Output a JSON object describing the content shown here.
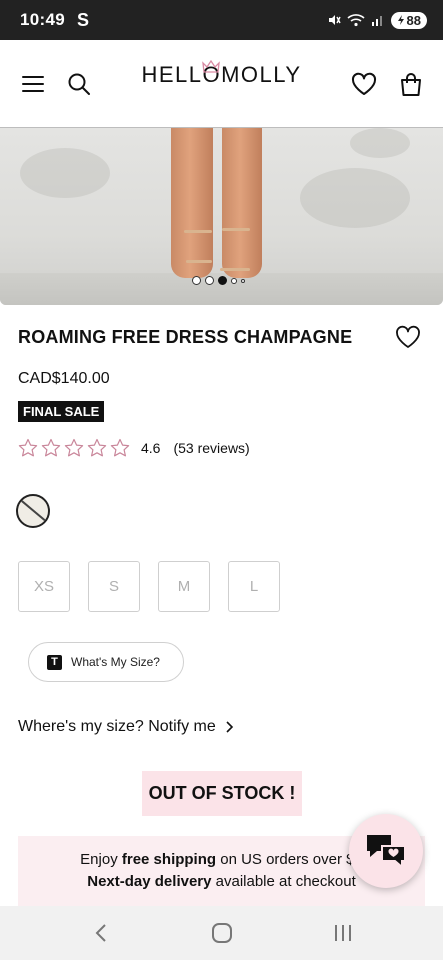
{
  "status_bar": {
    "time": "10:49",
    "carrier_icon": "S",
    "battery": "88",
    "icons": [
      "mute-icon",
      "wifi-icon",
      "signal-icon",
      "battery-icon"
    ]
  },
  "header": {
    "brand": "HELLOMOLLY",
    "icons": [
      "menu-icon",
      "search-icon",
      "heart-icon",
      "bag-icon"
    ]
  },
  "product": {
    "title": "ROAMING FREE DRESS CHAMPAGNE",
    "price": "CAD$140.00",
    "badge": "FINAL SALE",
    "rating": "4.6",
    "reviews": "(53 reviews)",
    "stars_filled": 0,
    "stars_total": 5,
    "carousel_index": 2,
    "carousel_count": 5,
    "sizes": [
      "XS",
      "S",
      "M",
      "L"
    ],
    "whats_my_size": "What's My Size?",
    "whats_my_size_logo": "T",
    "notify": "Where's my size? Notify me",
    "out_of_stock": "OUT OF STOCK !"
  },
  "shipping": {
    "line1_pre": "Enjoy ",
    "line1_bold": "free shipping",
    "line1_post": " on US orders over $1",
    "line2_bold": "Next-day delivery",
    "line2_post": " available at checkout"
  },
  "colors": {
    "accent_pink": "#fbe3e8",
    "banner_pink": "#fbeef1",
    "star_outline": "#c9869a",
    "text": "#111111"
  },
  "nav_bar": {
    "icons": [
      "back-icon",
      "home-icon",
      "recents-icon"
    ]
  }
}
